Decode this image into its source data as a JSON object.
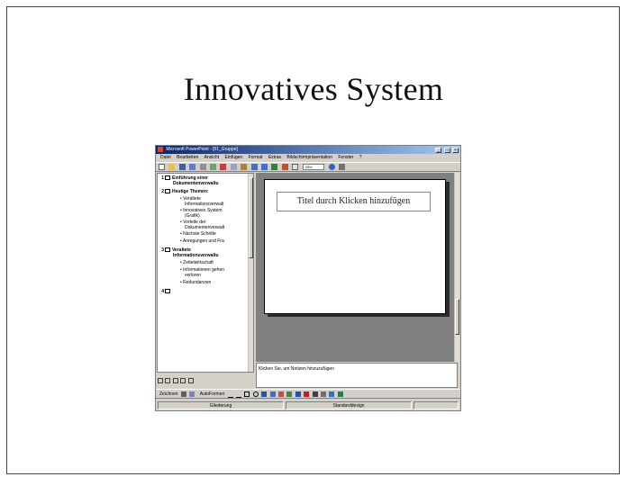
{
  "slide": {
    "title": "Innovatives System"
  },
  "app": {
    "window_title": "Microsoft PowerPoint - [01_Gruppe]",
    "menu": [
      "Datei",
      "Bearbeiten",
      "Ansicht",
      "Einfügen",
      "Format",
      "Extras",
      "Bildschirmpräsentation",
      "Fenster",
      "?"
    ],
    "zoom": "33%",
    "outline": [
      {
        "num": "1",
        "lines": [
          "Einführung einer",
          "Dokumentenverwaltu"
        ]
      },
      {
        "num": "2",
        "lines": [
          "Heutige Themen:"
        ]
      },
      {
        "bullet": true,
        "lines": [
          "Veraltete",
          "Informationsverwalt"
        ]
      },
      {
        "bullet": true,
        "lines": [
          "Innovatives System",
          "(Grafik)"
        ]
      },
      {
        "bullet": true,
        "lines": [
          "Vorteile der",
          "Dokumentenverwalt"
        ]
      },
      {
        "bullet": true,
        "lines": [
          "Nächste Schritte"
        ]
      },
      {
        "bullet": true,
        "lines": [
          "Anregungen und Fra"
        ]
      },
      {
        "num": "3",
        "lines": [
          "Veraltete",
          "Informationsverwaltu"
        ]
      },
      {
        "bullet": true,
        "lines": [
          "Zettelwirtschaft"
        ]
      },
      {
        "bullet": true,
        "lines": [
          "Informationen gehen",
          "verloren"
        ]
      },
      {
        "bullet": true,
        "lines": [
          "Redundanzen"
        ]
      },
      {
        "num": "4",
        "lines": [
          ""
        ]
      }
    ],
    "slide_placeholder": "Titel durch Klicken hinzufügen",
    "notes_placeholder": "Klicken Sie, um Notizen hinzuzufügen",
    "draw_toolbar": {
      "draw_label": "Zeichnen",
      "autoshapes_label": "AutoFormen"
    },
    "status": {
      "design": "Gliederung",
      "template": "Standarddesign"
    },
    "colors": {
      "titlebar": "#0a246a",
      "chrome": "#d4d0c8",
      "workspace": "#808080"
    }
  }
}
